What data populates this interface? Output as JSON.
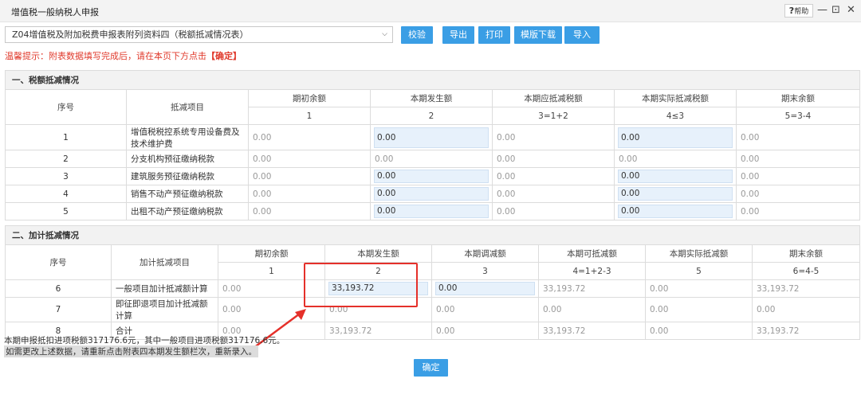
{
  "window": {
    "title": "增值税一般纳税人申报",
    "help_label": "帮助",
    "help_icon": "?",
    "minimize_glyph": "—",
    "restore_glyph": "⊡",
    "close_glyph": "✕"
  },
  "toolbar": {
    "selected_form": "Z04增值税及附加税费申报表附列资料四（税额抵减情况表）",
    "check_label": "校验",
    "export_label": "导出",
    "print_label": "打印",
    "template_download_label": "模版下载",
    "import_label": "导入"
  },
  "tip": {
    "prefix": "温馨提示：附表数据填写完成后，请在本页下方点击",
    "highlight": "【确定】"
  },
  "section1": {
    "title": "一、税额抵减情况",
    "headers": {
      "seq": "序号",
      "item": "抵减项目",
      "cols": [
        "期初余额",
        "本期发生额",
        "本期应抵减税额",
        "本期实际抵减税额",
        "期末余额"
      ],
      "col_nums": [
        "1",
        "2",
        "3=1+2",
        "4≤3",
        "5=3-4"
      ]
    },
    "rows": [
      {
        "seq": "1",
        "item": "增值税税控系统专用设备费及技术维护费",
        "values": [
          "0.00",
          "0.00",
          "0.00",
          "0.00",
          "0.00"
        ]
      },
      {
        "seq": "2",
        "item": "分支机构预征缴纳税款",
        "values": [
          "0.00",
          "0.00",
          "0.00",
          "0.00",
          "0.00"
        ]
      },
      {
        "seq": "3",
        "item": "建筑服务预征缴纳税款",
        "values": [
          "0.00",
          "0.00",
          "0.00",
          "0.00",
          "0.00"
        ]
      },
      {
        "seq": "4",
        "item": "销售不动产预征缴纳税款",
        "values": [
          "0.00",
          "0.00",
          "0.00",
          "0.00",
          "0.00"
        ]
      },
      {
        "seq": "5",
        "item": "出租不动产预征缴纳税款",
        "values": [
          "0.00",
          "0.00",
          "0.00",
          "0.00",
          "0.00"
        ]
      }
    ]
  },
  "section2": {
    "title": "二、加计抵减情况",
    "headers": {
      "seq": "序号",
      "item": "加计抵减项目",
      "cols": [
        "期初余额",
        "本期发生额",
        "本期调减额",
        "本期可抵减额",
        "本期实际抵减额",
        "期末余额"
      ],
      "col_nums": [
        "1",
        "2",
        "3",
        "4=1+2-3",
        "5",
        "6=4-5"
      ]
    },
    "rows": [
      {
        "seq": "6",
        "item": "一般项目加计抵减额计算",
        "values": [
          "0.00",
          "33,193.72",
          "0.00",
          "33,193.72",
          "0.00",
          "33,193.72"
        ]
      },
      {
        "seq": "7",
        "item": "即征即退项目加计抵减额计算",
        "values": [
          "0.00",
          "0.00",
          "0.00",
          "0.00",
          "0.00",
          "0.00"
        ]
      },
      {
        "seq": "8",
        "item": "合计",
        "values": [
          "0.00",
          "33,193.72",
          "0.00",
          "33,193.72",
          "0.00",
          "33,193.72"
        ]
      }
    ]
  },
  "notes": {
    "line1": "本期申报抵扣进项税额317176.6元，其中一般项目进项税额317176.6元。",
    "line2": "如需更改上述数据，请重新点击附表四本期发生额栏次，重新录入。"
  },
  "confirm_label": "确定",
  "colors": {
    "accent": "#3a9ee5",
    "warning": "#e03a2c",
    "annotation": "#e5302a",
    "editable_fill": "#e7f1fb"
  }
}
